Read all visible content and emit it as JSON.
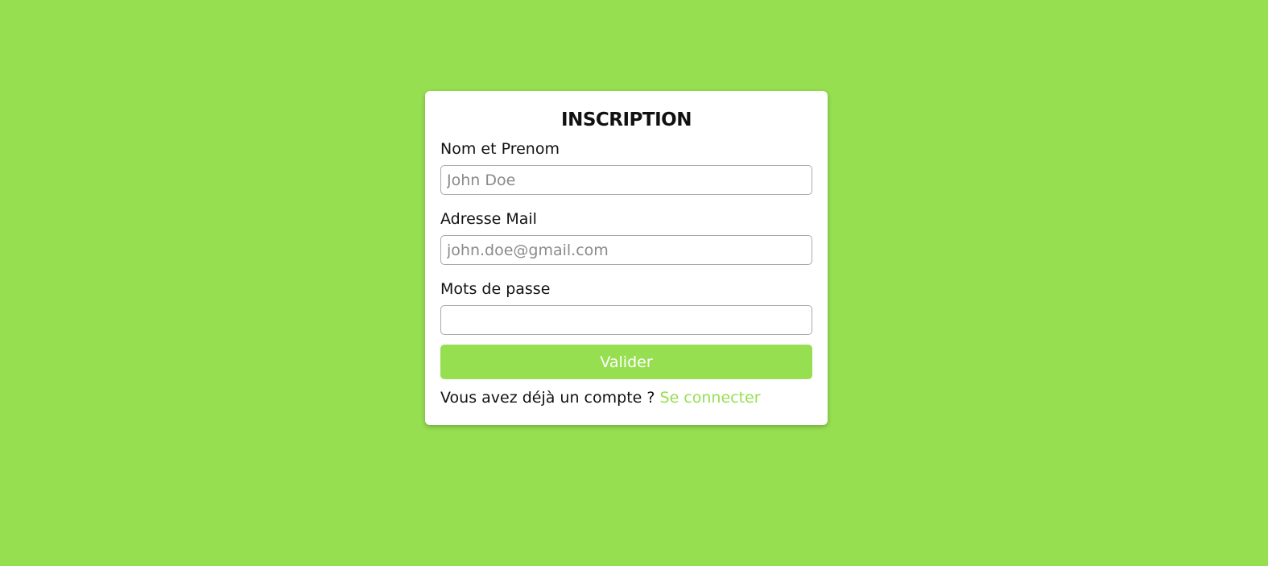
{
  "form": {
    "title": "INSCRIPTION",
    "name_field": {
      "label": "Nom et Prenom",
      "placeholder": "John Doe",
      "value": ""
    },
    "email_field": {
      "label": "Adresse Mail",
      "placeholder": "john.doe@gmail.com",
      "value": ""
    },
    "password_field": {
      "label": "Mots de passe",
      "placeholder": "",
      "value": ""
    },
    "submit_label": "Valider",
    "footer": {
      "text": "Vous avez déjà un compte ?",
      "link_label": "Se connecter"
    }
  },
  "colors": {
    "background": "#96df51",
    "accent": "#96df51",
    "card": "#ffffff",
    "text": "#111111"
  }
}
